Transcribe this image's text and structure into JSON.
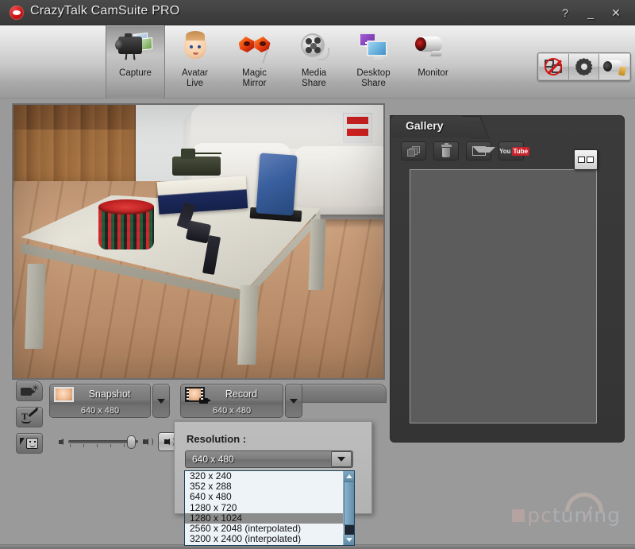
{
  "window": {
    "title": "CrazyTalk CamSuite PRO",
    "logo_icon": "lips-logo-icon",
    "buttons": {
      "help": "?",
      "minimize": "_",
      "close": "✕"
    }
  },
  "toolbar": {
    "items": [
      {
        "label": "Capture",
        "icon": "camera-photo-icon",
        "selected": true
      },
      {
        "label": "Avatar\nLive",
        "icon": "baby-face-icon",
        "selected": false
      },
      {
        "label": "Magic\nMirror",
        "icon": "carnival-mask-icon",
        "selected": false
      },
      {
        "label": "Media\nShare",
        "icon": "film-reel-icon",
        "selected": false
      },
      {
        "label": "Desktop\nShare",
        "icon": "monitors-share-icon",
        "selected": false
      },
      {
        "label": "Monitor",
        "icon": "webcam-icon",
        "selected": false
      }
    ],
    "right_buttons": [
      {
        "name": "disable-screen-share-button",
        "icon": "monitors-disabled-icon"
      },
      {
        "name": "settings-button",
        "icon": "gear-icon"
      },
      {
        "name": "camera-settings-button",
        "icon": "camera-wrench-icon"
      }
    ]
  },
  "preview": {
    "name": "video-preview",
    "description": "Webcam live view of a living room with a light wooden coffee table, a red and green plaid cup, a magazine box, a blue phone on a stand, a wristwatch, a toy tank, and a white sofa."
  },
  "gallery": {
    "tab_label": "Gallery",
    "toolbar": [
      {
        "name": "gallery-properties-button",
        "icon": "stacked-photos-icon"
      },
      {
        "name": "gallery-delete-button",
        "icon": "trash-icon"
      },
      {
        "name": "gallery-email-button",
        "icon": "mail-icon"
      },
      {
        "name": "gallery-youtube-button",
        "icon": "youtube-icon",
        "text_a": "You",
        "text_b": "Tube"
      }
    ],
    "view_toggle": {
      "name": "gallery-view-toggle-button",
      "icon": "two-pane-view-icon"
    },
    "items": []
  },
  "left_tools": [
    {
      "name": "video-effect-button",
      "icon": "video-effect-icon"
    },
    {
      "name": "text-tool-button",
      "icon": "text-pen-icon"
    },
    {
      "name": "sticker-tool-button",
      "icon": "sticker-smiley-icon"
    }
  ],
  "actions": {
    "snapshot": {
      "label": "Snapshot",
      "resolution": "640 x 480",
      "thumb_icon": "baby-photo-icon",
      "dropdown_icon": "chevron-down-icon"
    },
    "record": {
      "label": "Record",
      "resolution": "640 x 480",
      "thumb_icon": "film-strip-icon",
      "dropdown_icon": "chevron-down-icon"
    }
  },
  "volume": {
    "name": "volume-slider",
    "value_percent": 84,
    "low_icon": "speaker-low-icon",
    "high_icon": "speaker-high-icon",
    "mute_button_icon": "speaker-icon"
  },
  "resolution_popup": {
    "title": "Resolution :",
    "selected_value": "640 x 480",
    "combo_arrow_icon": "chevron-down-icon",
    "options": [
      {
        "label": "320 x 240",
        "selected": false
      },
      {
        "label": "352 x 288",
        "selected": false
      },
      {
        "label": "640 x 480",
        "selected": false
      },
      {
        "label": "1280 x 720",
        "selected": false
      },
      {
        "label": "1280 x 1024",
        "selected": true
      },
      {
        "label": "2560 x 2048 (interpolated)",
        "selected": false
      },
      {
        "label": "3200 x 2400 (interpolated)",
        "selected": false
      }
    ],
    "scrollbar": {
      "up_icon": "scroll-up-arrow-icon",
      "down_icon": "scroll-down-arrow-icon"
    }
  },
  "watermark": {
    "text_a": "pc",
    "text_b": "tuning"
  },
  "colors": {
    "window_bg": "#9a9a9a",
    "titlebar": "#3f3f3f",
    "panel_dark": "#383838",
    "accent_blue": "#5f8cab",
    "youtube_red": "#c8232c",
    "selection_gray": "#8c8c8c"
  }
}
